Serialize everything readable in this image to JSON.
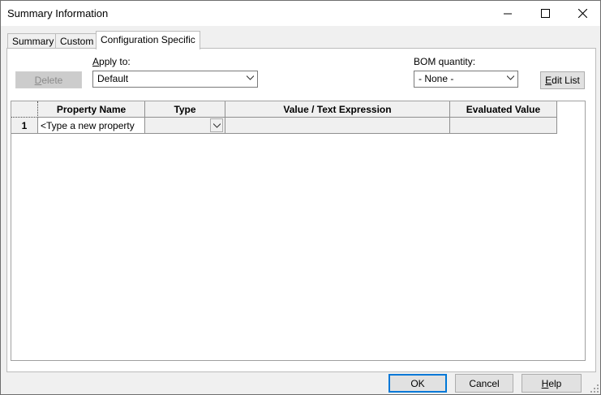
{
  "window": {
    "title": "Summary Information"
  },
  "tabs": [
    {
      "label": "Summary"
    },
    {
      "label": "Custom"
    },
    {
      "label": "Configuration Specific"
    }
  ],
  "toolbar": {
    "delete_label_first": "D",
    "delete_label_rest": "elete",
    "apply_to_label_first": "A",
    "apply_to_label_rest": "pply to:",
    "apply_to_value": "Default",
    "bom_label": "BOM quantity:",
    "bom_value": "- None -",
    "edit_list_first": "E",
    "edit_list_rest": "dit List"
  },
  "grid": {
    "columns": [
      "",
      "Property Name",
      "Type",
      "Value / Text Expression",
      "Evaluated Value"
    ],
    "rows": [
      {
        "num": "1",
        "property": "<Type a new property",
        "type": "",
        "value": "",
        "evaluated": ""
      }
    ]
  },
  "footer": {
    "ok_label": "OK",
    "cancel_label": "Cancel",
    "help_first": "H",
    "help_rest": "elp"
  }
}
